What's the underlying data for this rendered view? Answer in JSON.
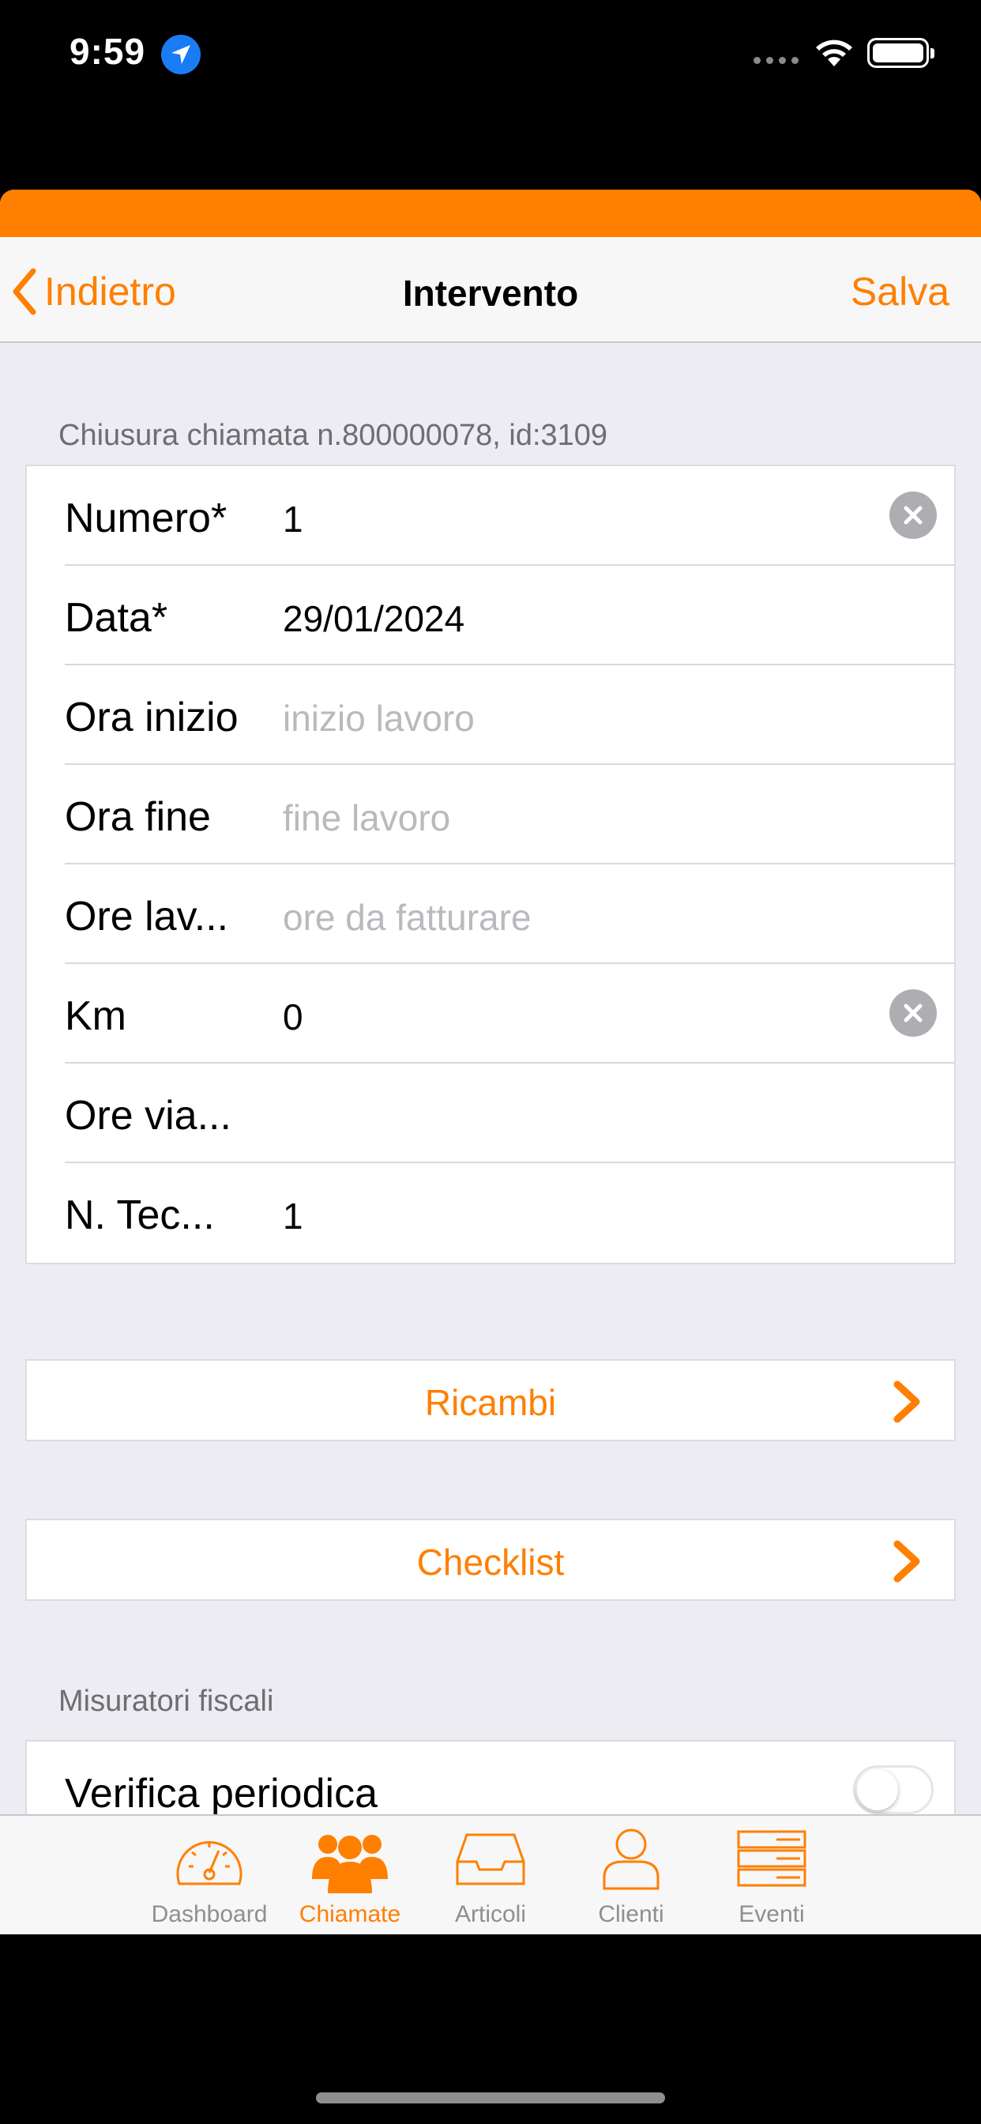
{
  "status_bar": {
    "time": "9:59",
    "location_icon": "location-arrow-icon",
    "wifi_icon": "wifi-icon",
    "battery_icon": "battery-full-icon"
  },
  "navbar": {
    "back_label": "Indietro",
    "title": "Intervento",
    "save_label": "Salva"
  },
  "form": {
    "section_header": "Chiusura chiamata n.800000078, id:3109",
    "rows": [
      {
        "label": "Numero*",
        "value": "1",
        "placeholder": ""
      },
      {
        "label": "Data*",
        "value": "29/01/2024",
        "placeholder": ""
      },
      {
        "label": "Ora inizio",
        "value": "",
        "placeholder": "inizio lavoro"
      },
      {
        "label": "Ora fine",
        "value": "",
        "placeholder": "fine lavoro"
      },
      {
        "label": "Ore lav...",
        "value": "",
        "placeholder": "ore da fatturare"
      },
      {
        "label": "Km",
        "value": "0",
        "placeholder": ""
      },
      {
        "label": "Ore via...",
        "value": "",
        "placeholder": ""
      },
      {
        "label": "N. Tec...",
        "value": "1",
        "placeholder": ""
      }
    ]
  },
  "links": {
    "ricambi": "Ricambi",
    "checklist": "Checklist"
  },
  "fiscal": {
    "section_header": "Misuratori fiscali",
    "toggle_label": "Verifica periodica",
    "toggle_on": false
  },
  "tabbar": {
    "active": "Chiamate",
    "items": [
      {
        "label": "Dashboard",
        "icon": "dashboard-gauge-icon"
      },
      {
        "label": "Chiamate",
        "icon": "people-group-icon"
      },
      {
        "label": "Articoli",
        "icon": "inbox-tray-icon"
      },
      {
        "label": "Clienti",
        "icon": "person-icon"
      },
      {
        "label": "Eventi",
        "icon": "list-rows-icon"
      }
    ]
  },
  "colors": {
    "accent": "#ff7f00",
    "background": "#edecf2",
    "placeholder": "#b9b9be",
    "inactive_tab": "#8e8e93"
  }
}
